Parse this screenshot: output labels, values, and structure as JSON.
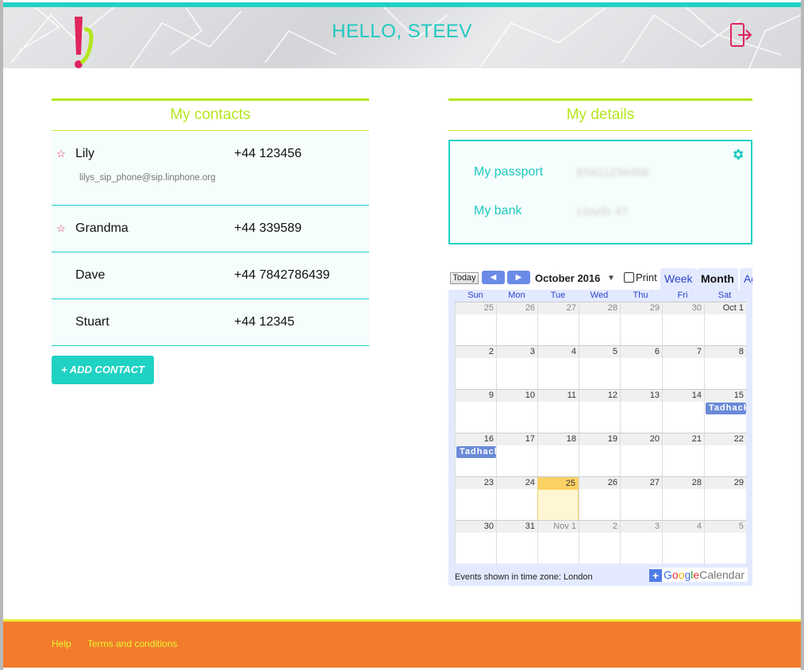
{
  "header": {
    "greeting": "HELLO, STEEV",
    "logo_icon": "exclamation-logo-icon",
    "logout_icon": "logout-icon"
  },
  "contacts": {
    "title": "My contacts",
    "items": [
      {
        "name": "Lily",
        "phone": "+44 123456",
        "sip": "lilys_sip_phone@sip.linphone.org",
        "favorite": true
      },
      {
        "name": "Grandma",
        "phone": "+44 339589",
        "sip": "",
        "favorite": true
      },
      {
        "name": "Dave",
        "phone": "+44 7842786439",
        "sip": "",
        "favorite": false
      },
      {
        "name": "Stuart",
        "phone": "+44 12345",
        "sip": "",
        "favorite": false
      }
    ],
    "add_label": "+ ADD CONTACT",
    "star_glyph": "☆"
  },
  "details": {
    "title": "My details",
    "rows": [
      {
        "label": "My passport",
        "value": "ENG1234456"
      },
      {
        "label": "My bank",
        "value": "Lloyds 47"
      }
    ]
  },
  "calendar": {
    "today_label": "Today",
    "prev_glyph": "◀",
    "next_glyph": "▶",
    "month_title": "October 2016",
    "dropdown_glyph": "▼",
    "print_label": "Print",
    "tabs": [
      "Week",
      "Month",
      "Ag"
    ],
    "active_tab": "Month",
    "weekdays": [
      "Sun",
      "Mon",
      "Tue",
      "Wed",
      "Thu",
      "Fri",
      "Sat"
    ],
    "weeks": [
      [
        "25",
        "26",
        "27",
        "28",
        "29",
        "30",
        "Oct 1"
      ],
      [
        "2",
        "3",
        "4",
        "5",
        "6",
        "7",
        "8"
      ],
      [
        "9",
        "10",
        "11",
        "12",
        "13",
        "14",
        "15"
      ],
      [
        "16",
        "17",
        "18",
        "19",
        "20",
        "21",
        "22"
      ],
      [
        "23",
        "24",
        "25",
        "26",
        "27",
        "28",
        "29"
      ],
      [
        "30",
        "31",
        "Nov 1",
        "2",
        "3",
        "4",
        "5"
      ]
    ],
    "events": [
      {
        "title": "Tadhack",
        "week": 2,
        "day": 6
      },
      {
        "title": "Tadhack",
        "week": 3,
        "day": 0
      }
    ],
    "today": {
      "week": 4,
      "day": 2
    },
    "timezone_note": "Events shown in time zone: London",
    "gcal_plus": "+",
    "gcal_google": "Google",
    "gcal_calendar": "Calendar"
  },
  "footer": {
    "links": [
      "Help",
      "Terms and conditions"
    ]
  }
}
